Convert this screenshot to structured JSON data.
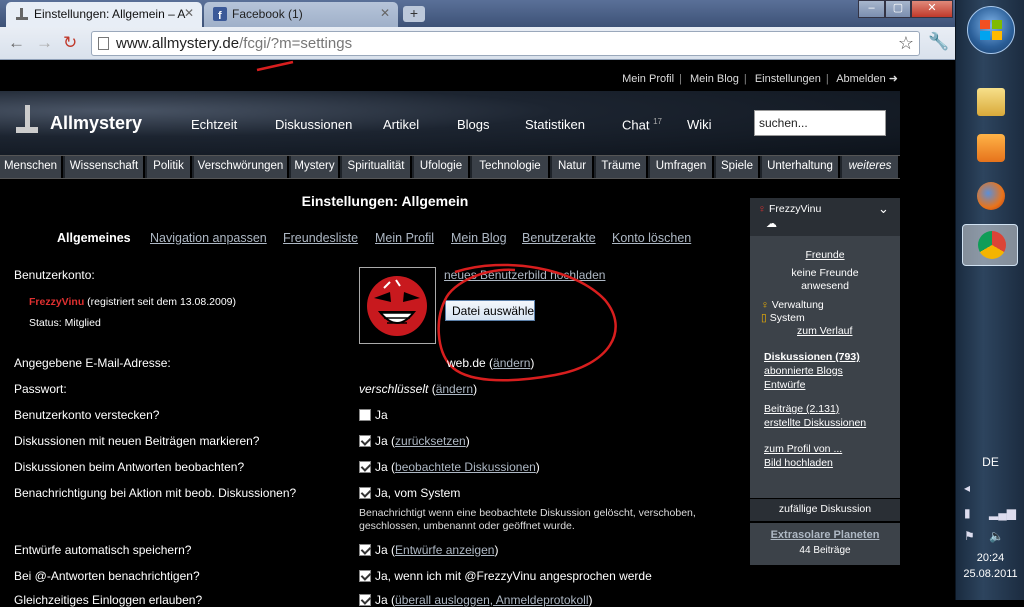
{
  "browser": {
    "tabs": [
      {
        "label": "Einstellungen: Allgemein – A",
        "active": true
      },
      {
        "label": "Facebook (1)",
        "active": false
      }
    ],
    "url_host": "www.allmystery.de",
    "url_path": "/fcgi/?m=settings",
    "window_controls": [
      "–",
      "▢",
      "✕"
    ]
  },
  "taskbar": {
    "language": "DE",
    "time": "20:24",
    "date": "25.08.2011",
    "apps": [
      "windows-explorer",
      "media-player",
      "firefox",
      "chrome"
    ]
  },
  "site": {
    "logo": "Allmystery",
    "top_links": [
      "Mein Profil",
      "Mein Blog",
      "Einstellungen",
      "Abmelden ➜"
    ],
    "main_nav": [
      "Echtzeit",
      "Diskussionen",
      "Artikel",
      "Blogs",
      "Statistiken",
      "Chat",
      "Wiki"
    ],
    "chat_count": "17",
    "search_placeholder": "suchen...",
    "categories": [
      "Menschen",
      "Wissenschaft",
      "Politik",
      "Verschwörungen",
      "Mystery",
      "Spiritualität",
      "Ufologie",
      "Technologie",
      "Natur",
      "Träume",
      "Umfragen",
      "Spiele",
      "Unterhaltung",
      "weiteres"
    ]
  },
  "settings": {
    "title": "Einstellungen: Allgemein",
    "subtabs": [
      "Allgemeines",
      "Navigation anpassen",
      "Freundesliste",
      "Mein Profil",
      "Mein Blog",
      "Benutzerakte",
      "Konto löschen"
    ],
    "account_label": "Benutzerkonto:",
    "username": "FrezzyVinu",
    "registered": "(registriert seit dem 13.08.2009)",
    "status": "Status: Mitglied",
    "upload_link": "neues Benutzerbild hochladen",
    "file_button": "Datei auswählen",
    "email_label": "Angegebene E-Mail-Adresse:",
    "email_value": "web.de",
    "change_link": "ändern",
    "password_label": "Passwort:",
    "password_value": "verschlüsselt",
    "hide_label": "Benutzerkonto verstecken?",
    "hide_value": "Ja",
    "mark_label": "Diskussionen mit neuen Beiträgen markieren?",
    "mark_value": "Ja",
    "mark_link": "zurücksetzen",
    "watch_label": "Diskussionen beim Antworten beobachten?",
    "watch_value": "Ja",
    "watch_link": "beobachtete Diskussionen",
    "notify_label": "Benachrichtigung bei Aktion mit beob. Diskussionen?",
    "notify_value": "Ja, vom System",
    "notify_note": "Benachrichtigt wenn eine beobachtete Diskussion gelöscht, verschoben, geschlossen, umbenannt oder geöffnet wurde.",
    "drafts_label": "Entwürfe automatisch speichern?",
    "drafts_value": "Ja",
    "drafts_link": "Entwürfe anzeigen",
    "mention_label": "Bei @-Antworten benachrichtigen?",
    "mention_value": "Ja, wenn ich mit @FrezzyVinu angesprochen werde",
    "parallel_label": "Gleichzeitiges Einloggen erlauben?",
    "parallel_value": "Ja",
    "parallel_link": "überall ausloggen, Anmeldeprotokoll"
  },
  "sidebar": {
    "user": "FrezzyVinu",
    "friends_link": "Freunde",
    "friends_status_1": "keine Freunde",
    "friends_status_2": "anwesend",
    "admin": "Verwaltung",
    "system": "System",
    "history_link": "zum Verlauf",
    "discussions_link": "Diskussionen (793)",
    "blogs_link": "abonnierte Blogs",
    "drafts_link": "Entwürfe",
    "posts_link": "Beiträge (2.131)",
    "created_link": "erstellte Diskussionen",
    "profile_link": "zum Profil von ...",
    "image_link": "Bild hochladen",
    "random_head": "zufällige Diskussion",
    "random_title": "Extrasolare Planeten",
    "random_count": "44 Beiträge"
  },
  "colors": {
    "annotation_red": "#d81e1e",
    "link": "#aeb8c4",
    "sidebar_bg": "#3c4249"
  }
}
